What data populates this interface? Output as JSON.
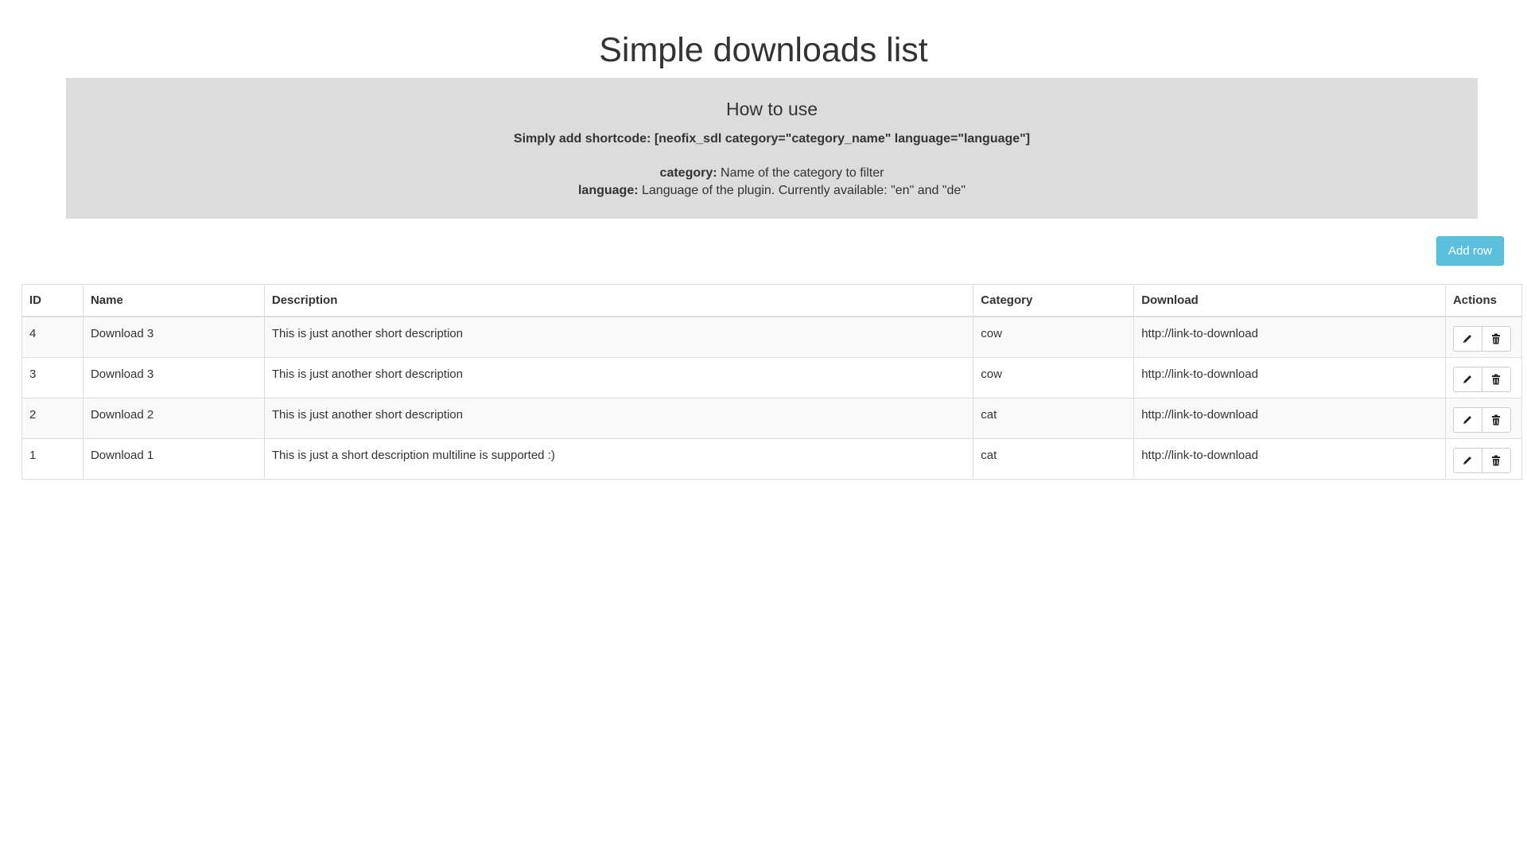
{
  "page": {
    "title": "Simple downloads list"
  },
  "info": {
    "heading": "How to use",
    "shortcode": "Simply add shortcode: [neofix_sdl category=\"category_name\" language=\"language\"]",
    "params": [
      {
        "name": "category:",
        "text": " Name of the category to filter"
      },
      {
        "name": "language:",
        "text": " Language of the plugin. Currently available: \"en\" and \"de\""
      }
    ]
  },
  "toolbar": {
    "add_row_label": "Add row"
  },
  "table": {
    "headers": [
      "ID",
      "Name",
      "Description",
      "Category",
      "Download",
      "Actions"
    ],
    "rows": [
      {
        "id": "4",
        "name": "Download 3",
        "description": "This is just another short description",
        "category": "cow",
        "download": "http://link-to-download"
      },
      {
        "id": "3",
        "name": "Download 3",
        "description": "This is just another short description",
        "category": "cow",
        "download": "http://link-to-download"
      },
      {
        "id": "2",
        "name": "Download 2",
        "description": "This is just another short description",
        "category": "cat",
        "download": "http://link-to-download"
      },
      {
        "id": "1",
        "name": "Download 1",
        "description": "This is just a short description multiline is supported :)",
        "category": "cat",
        "download": "http://link-to-download"
      }
    ],
    "row_actions": [
      {
        "icon": "pencil-icon",
        "action": "edit"
      },
      {
        "icon": "trash-icon",
        "action": "delete"
      }
    ]
  },
  "colors": {
    "info_background": "#dcdcdc",
    "add_button": "#5bc0de",
    "table_border": "#dddddd",
    "striped_row": "#f9f9f9"
  }
}
